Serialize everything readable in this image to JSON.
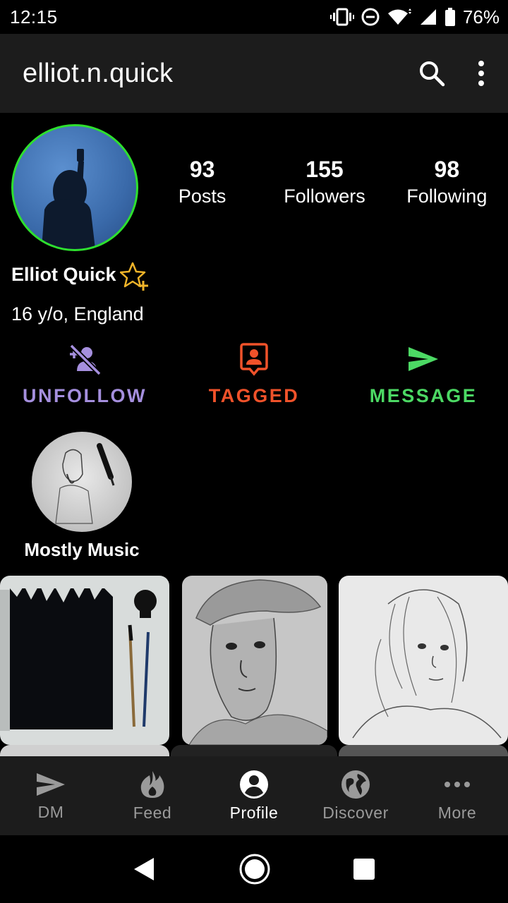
{
  "status_bar": {
    "time": "12:15",
    "battery": "76%"
  },
  "app_bar": {
    "title": "elliot.n.quick"
  },
  "profile": {
    "stats": [
      {
        "value": "93",
        "label": "Posts"
      },
      {
        "value": "155",
        "label": "Followers"
      },
      {
        "value": "98",
        "label": "Following"
      }
    ],
    "display_name": "Elliot Quick",
    "bio": "16 y/o, England"
  },
  "actions": {
    "unfollow": {
      "label": "UNFOLLOW",
      "color": "#a58fde"
    },
    "tagged": {
      "label": "TAGGED",
      "color": "#f0522a"
    },
    "message": {
      "label": "MESSAGE",
      "color": "#4cd964"
    }
  },
  "highlights": [
    {
      "label": "Mostly Music"
    }
  ],
  "bottom_nav": {
    "items": [
      {
        "label": "DM",
        "icon": "send-icon"
      },
      {
        "label": "Feed",
        "icon": "flame-icon"
      },
      {
        "label": "Profile",
        "icon": "account-icon",
        "active": true
      },
      {
        "label": "Discover",
        "icon": "globe-icon"
      },
      {
        "label": "More",
        "icon": "more-horizontal-icon"
      }
    ]
  }
}
